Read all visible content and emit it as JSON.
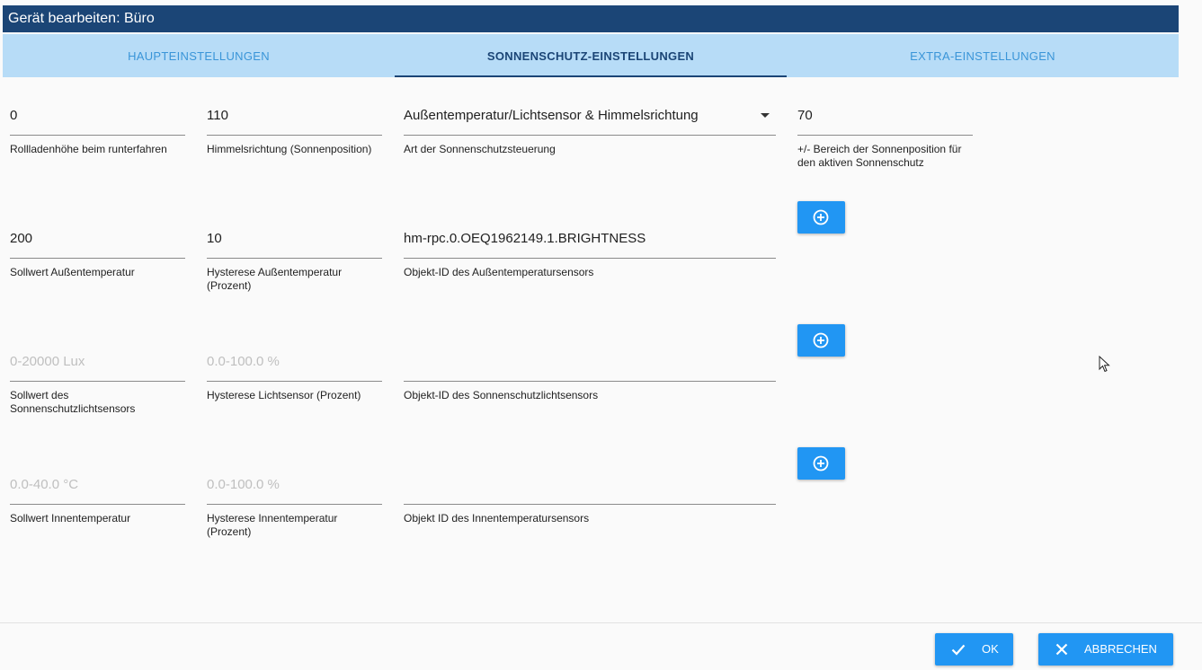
{
  "window": {
    "title": "Gerät bearbeiten: Büro"
  },
  "tabs": [
    {
      "label": "HAUPTEINSTELLUNGEN",
      "active": false
    },
    {
      "label": "SONNENSCHUTZ-EINSTELLUNGEN",
      "active": true
    },
    {
      "label": "EXTRA-EINSTELLUNGEN",
      "active": false
    }
  ],
  "colors": {
    "titlebar": "#1b4576",
    "tabs_background": "#b7dcf7",
    "tab_inactive": "#3a95d8",
    "tab_active": "#1b4576",
    "button": "#2196f3"
  },
  "form": {
    "rows": [
      {
        "shutter_height": {
          "value": "0",
          "label": "Rollladenhöhe beim runterfahren"
        },
        "direction": {
          "value": "110",
          "label": "Himmelsrichtung (Sonnenposition)"
        },
        "control_type": {
          "value": "Außentemperatur/Lichtsensor & Himmelsrichtung",
          "label": "Art der Sonnenschutzsteuerung",
          "icon": "dropdown-arrow-icon"
        },
        "sun_range": {
          "value": "70",
          "label": "+/- Bereich der Sonnenposition für den aktiven Sonnenschutz"
        }
      },
      {
        "outside_temp_setpoint": {
          "value": "200",
          "label": "Sollwert Außentemperatur"
        },
        "outside_temp_hysteresis": {
          "value": "10",
          "label": "Hysterese Außentemperatur (Prozent)"
        },
        "outside_temp_sensor": {
          "value": "hm-rpc.0.OEQ1962149.1.BRIGHTNESS",
          "label": "Objekt-ID des Außentemperatursensors"
        }
      },
      {
        "light_setpoint": {
          "placeholder": "0-20000 Lux",
          "label": "Sollwert des Sonnenschutzlichtsensors"
        },
        "light_hysteresis": {
          "placeholder": "0.0-100.0 %",
          "label": "Hysterese Lichtsensor (Prozent)"
        },
        "light_sensor": {
          "value": "",
          "label": "Objekt-ID des Sonnenschutzlichtsensors"
        }
      },
      {
        "inside_temp_setpoint": {
          "placeholder": "0.0-40.0 °C",
          "label": "Sollwert Innentemperatur"
        },
        "inside_temp_hysteresis": {
          "placeholder": "0.0-100.0 %",
          "label": "Hysterese Innentemperatur (Prozent)"
        },
        "inside_temp_sensor": {
          "value": "",
          "label": "Objekt ID des Innentemperatursensors"
        }
      }
    ],
    "add_button_icon": "add-circle-icon"
  },
  "footer": {
    "ok_label": "OK",
    "ok_icon": "check-icon",
    "cancel_label": "ABBRECHEN",
    "cancel_icon": "close-icon"
  }
}
